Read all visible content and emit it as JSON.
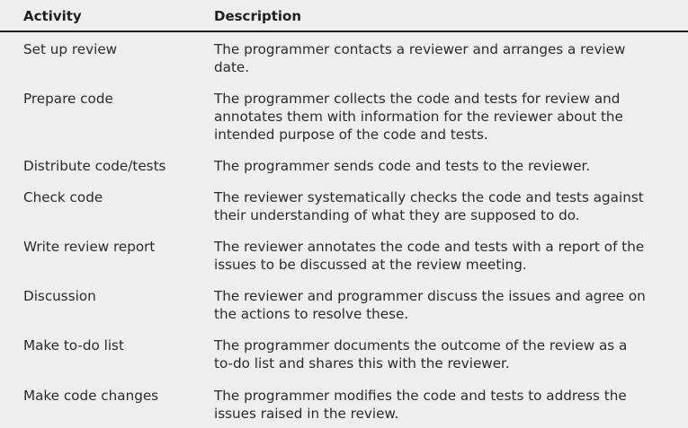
{
  "table": {
    "headers": {
      "activity": "Activity",
      "description": "Description"
    },
    "rows": [
      {
        "activity": "Set up review",
        "description_lines": [
          "The programmer contacts a reviewer and arranges a review",
          "date."
        ]
      },
      {
        "activity": "Prepare code",
        "description_lines": [
          "The programmer collects the code and tests for review and",
          "annotates them with information for the reviewer about the",
          "intended purpose of the code and tests."
        ]
      },
      {
        "activity": "Distribute code/tests",
        "description_lines": [
          "The programmer sends code and tests to the reviewer."
        ]
      },
      {
        "activity": "Check code",
        "description_lines": [
          "The reviewer systematically checks the code and tests against",
          "their understanding of what they are supposed to do."
        ]
      },
      {
        "activity": "Write review report",
        "description_lines": [
          "The reviewer annotates the code and tests with a report of the",
          "issues to be discussed at the review meeting."
        ]
      },
      {
        "activity": "Discussion",
        "description_lines": [
          "The reviewer and programmer discuss the issues and agree on",
          "the actions to resolve these."
        ]
      },
      {
        "activity": "Make to-do list",
        "description_lines": [
          "The programmer documents the outcome of the review as a",
          "to-do list and shares this with the reviewer."
        ]
      },
      {
        "activity": "Make code changes",
        "description_lines": [
          "The programmer modifies the code and tests to address the",
          "issues raised in the review."
        ]
      }
    ]
  }
}
